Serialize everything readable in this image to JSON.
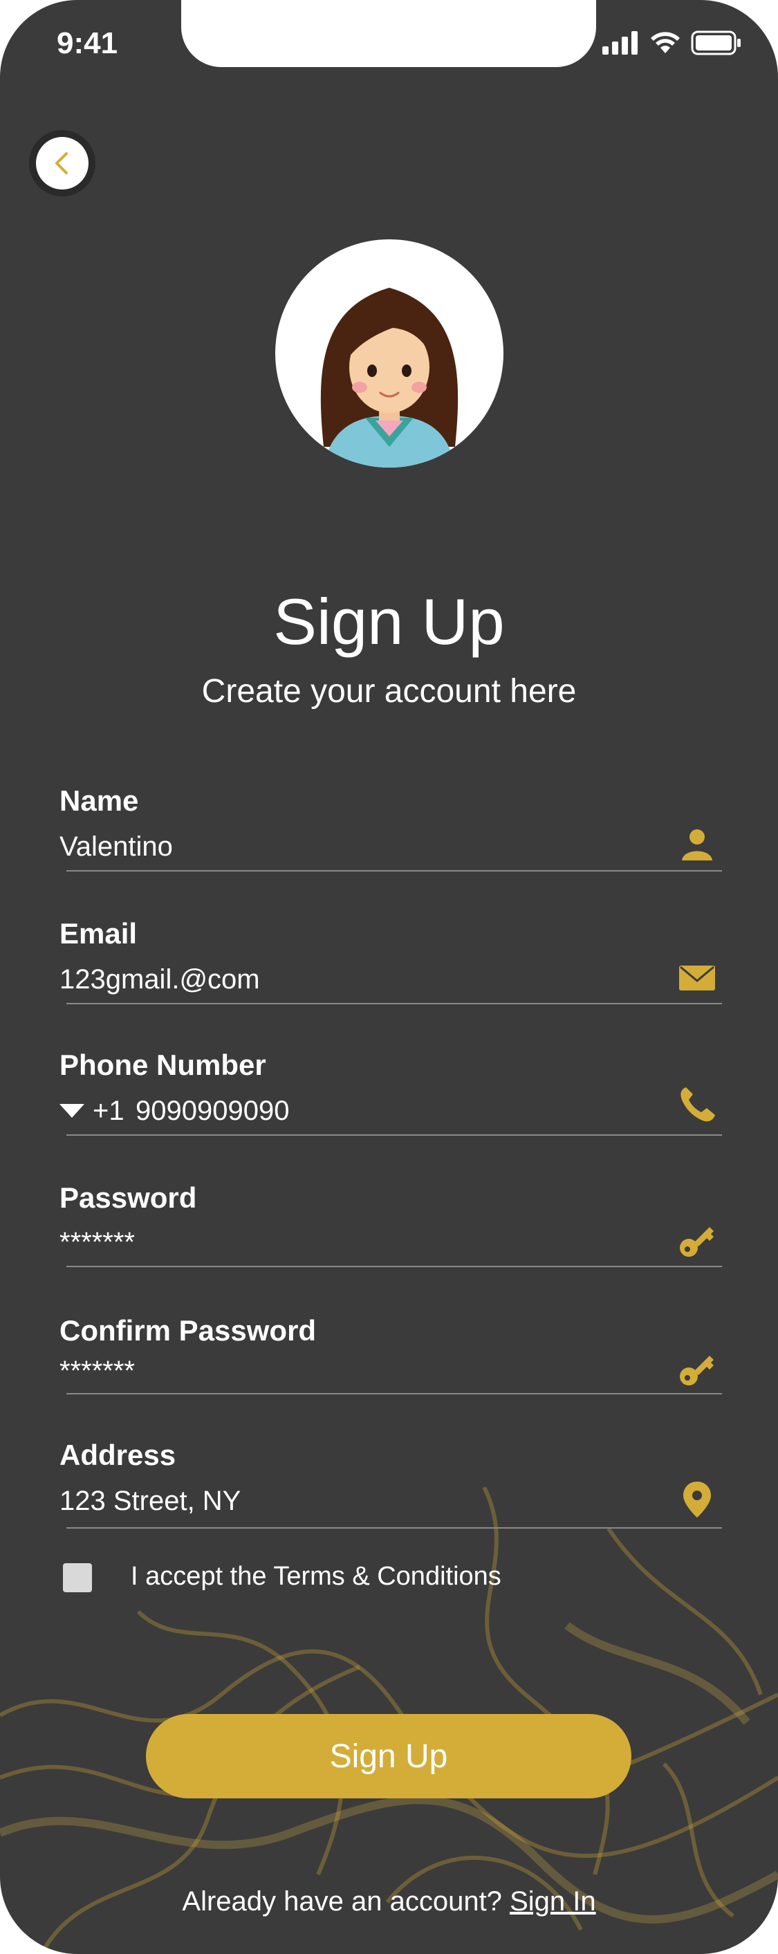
{
  "status_bar": {
    "time": "9:41"
  },
  "header": {
    "title": "Sign Up",
    "subtitle": "Create your account here"
  },
  "form": {
    "name": {
      "label": "Name",
      "value": "Valentino"
    },
    "email": {
      "label": "Email",
      "value": "123gmail.@com"
    },
    "phone": {
      "label": "Phone Number",
      "country_code": "+1",
      "value": "9090909090"
    },
    "password": {
      "label": "Password",
      "value": "*******"
    },
    "confirm_password": {
      "label": "Confirm Password",
      "value": "*******"
    },
    "address": {
      "label": "Address",
      "value": "123 Street, NY"
    },
    "terms": {
      "label": "I accept the Terms & Conditions",
      "checked": false
    }
  },
  "actions": {
    "signup_label": "Sign Up"
  },
  "footer": {
    "prompt": "Already have an account?",
    "link": "Sign In"
  },
  "colors": {
    "background": "#3b3b3b",
    "accent": "#d4ad38",
    "text": "#ffffff"
  },
  "icons": [
    "back-chevron-icon",
    "user-icon",
    "envelope-icon",
    "phone-icon",
    "key-icon",
    "map-pin-icon",
    "dropdown-triangle-icon"
  ]
}
